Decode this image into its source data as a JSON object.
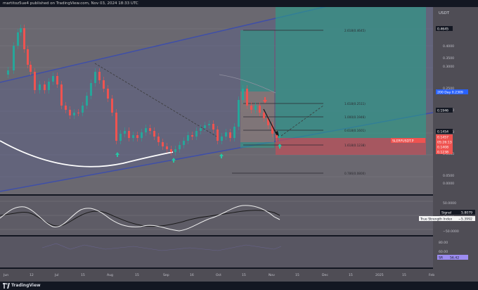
{
  "header": {
    "publish_text": "martitoz5ue4 published on TradingView.com, Nov 03, 2024 18:33 UTC"
  },
  "symbol": {
    "info": "SLERFUSDT Perpetual Contract, 1D, BYBIT  O 0.1562  H 0.1567  L 0.1408  C 0.1453  −0.0109 (−6.98%)"
  },
  "currency": "USDT",
  "colors": {
    "bull": "#26a69a",
    "bear": "#ef5350",
    "channel": "#3f4fa8",
    "background": "#6a6870",
    "label_blue": "#2962ff"
  },
  "price_axis": {
    "ticks": [
      "0.4000",
      "0.3500",
      "0.3000",
      "0.2500",
      "0.2000",
      "0.1500",
      "0.1000",
      "0.0500",
      "0.0000"
    ],
    "labels": [
      {
        "text": "0.4645",
        "kind": "dark"
      },
      {
        "text": "200 Day   0.2309",
        "kind": "blue"
      },
      {
        "text": "0.1946",
        "kind": "dark"
      },
      {
        "text": "0.1454",
        "kind": "dark"
      },
      {
        "text": "0.1457",
        "kind": "red"
      },
      {
        "text": "05:26:13",
        "kind": "red"
      },
      {
        "text": "0.1408",
        "kind": "red"
      },
      {
        "text": "0.1238",
        "kind": "red"
      }
    ]
  },
  "symbol_tag": "SLERFUSDT.P",
  "fib_labels": [
    "2.618(0.4645)",
    "1.618(0.2511)",
    "1.000(0.1946)",
    "0.618(0.1601)",
    "1.618(0.1238)",
    "0.786(0.0800)"
  ],
  "oscillator": {
    "ticks": [
      "50.0000",
      "0.0000",
      "−50.0000"
    ],
    "labels": [
      {
        "name": "Signal",
        "value": "5.8079"
      },
      {
        "name": "True Strength Index",
        "value": "−5.3992"
      }
    ]
  },
  "third_pane": {
    "ticks": [
      "80.00",
      "60.00"
    ],
    "label": {
      "name": "SR",
      "value": "56.42"
    }
  },
  "time_axis": {
    "labels": [
      "Jun",
      "12",
      "Jul",
      "15",
      "Aug",
      "15",
      "Sep",
      "16",
      "Oct",
      "15",
      "Nov",
      "15",
      "Dec",
      "15",
      "2025",
      "15",
      "Feb"
    ]
  },
  "footer": {
    "brand": "TradingView"
  }
}
